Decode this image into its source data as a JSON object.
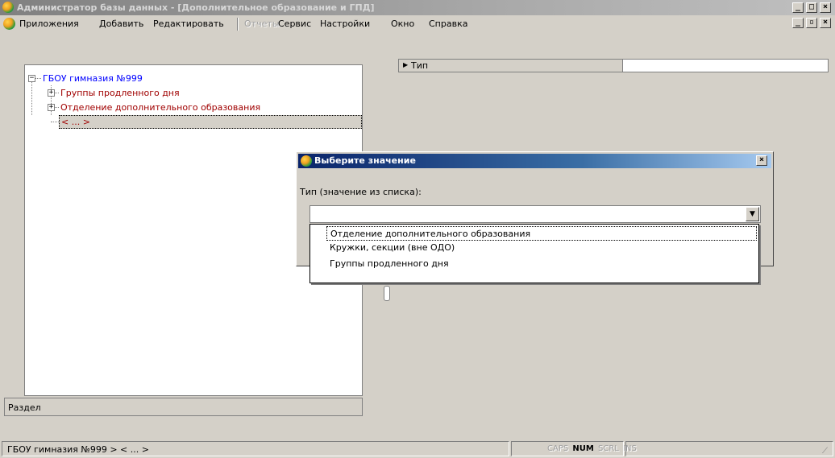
{
  "window": {
    "title": "Администратор базы данных - [Дополнительное образование и ГПД]"
  },
  "menu": {
    "items": [
      "Приложения",
      "Добавить",
      "Редактировать",
      "Отчеты",
      "Сервис",
      "Настройки",
      "Окно",
      "Справка"
    ]
  },
  "tree": {
    "root": "ГБОУ гимназия №999",
    "children": [
      "Группы продленного дня",
      "Отделение дополнительного образования",
      "< ... >"
    ]
  },
  "section_label": "Раздел",
  "property_grid": {
    "label": "Тип",
    "value": ""
  },
  "dialog": {
    "title": "Выберите значение",
    "field_label": "Тип (значение из списка):",
    "selected_value": "",
    "options": [
      "Отделение дополнительного образования",
      "Кружки, секции (вне ОДО)",
      "Группы продленного дня"
    ]
  },
  "statusbar": {
    "path": "ГБОУ гимназия №999 > < ... >",
    "caps": "CAPS",
    "num": "NUM",
    "scrl": "SCRL",
    "ins": "INS"
  },
  "colors": {
    "tree_root": "#0000ff",
    "tree_child": "#a00000",
    "dialog_title_start": "#0a246a"
  }
}
